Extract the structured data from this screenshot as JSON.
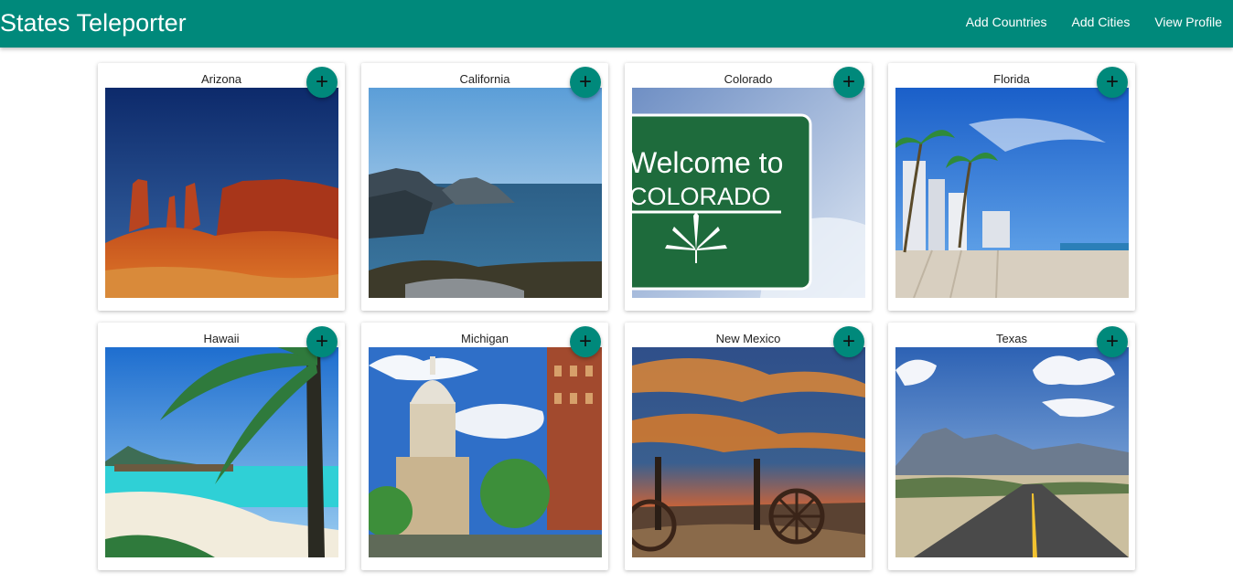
{
  "app": {
    "title": "States Teleporter"
  },
  "nav": [
    {
      "label": "Add Countries"
    },
    {
      "label": "Add Cities"
    },
    {
      "label": "View Profile"
    }
  ],
  "add_icon": "+",
  "cards": [
    {
      "name": "Arizona"
    },
    {
      "name": "California"
    },
    {
      "name": "Colorado",
      "sign_line1": "Welcome to",
      "sign_line2": "COLORADO"
    },
    {
      "name": "Florida"
    },
    {
      "name": "Hawaii"
    },
    {
      "name": "Michigan"
    },
    {
      "name": "New Mexico"
    },
    {
      "name": "Texas"
    }
  ],
  "colors": {
    "primary": "#00897b"
  }
}
